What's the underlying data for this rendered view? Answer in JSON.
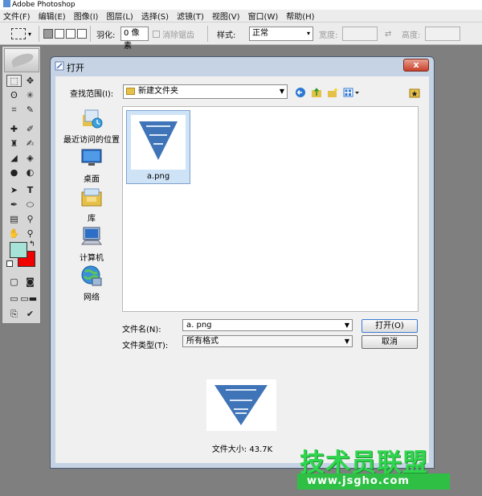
{
  "app": {
    "title": "Adobe Photoshop"
  },
  "menu": [
    "文件(F)",
    "编辑(E)",
    "图像(I)",
    "图层(L)",
    "选择(S)",
    "滤镜(T)",
    "视图(V)",
    "窗口(W)",
    "帮助(H)"
  ],
  "options_bar": {
    "feather_label": "羽化:",
    "feather_value": "0 像素",
    "antialias_label": "消除锯齿",
    "style_label": "样式:",
    "style_value": "正常",
    "width_label": "宽度:",
    "height_label": "高度:"
  },
  "dialog": {
    "title": "打开",
    "close_label": "x",
    "look_in_label": "查找范围(I):",
    "look_in_value": "新建文件夹",
    "places": [
      {
        "label": "最近访问的位置",
        "icon": "recent-places-icon"
      },
      {
        "label": "桌面",
        "icon": "desktop-icon"
      },
      {
        "label": "库",
        "icon": "library-icon"
      },
      {
        "label": "计算机",
        "icon": "computer-icon"
      },
      {
        "label": "网络",
        "icon": "network-icon"
      }
    ],
    "files": [
      {
        "name": "a.png"
      }
    ],
    "file_name_label": "文件名(N):",
    "file_name_value": "a. png",
    "file_type_label": "文件类型(T):",
    "file_type_value": "所有格式",
    "open_label": "打开(O)",
    "cancel_label": "取消",
    "file_size": "文件大小: 43.7K"
  },
  "watermark": {
    "title": "技术员联盟",
    "url": "www.jsgho.com"
  },
  "colors": {
    "foreground": "#a6e3d6",
    "background": "#f00000",
    "accent_green": "#2fbf45"
  }
}
